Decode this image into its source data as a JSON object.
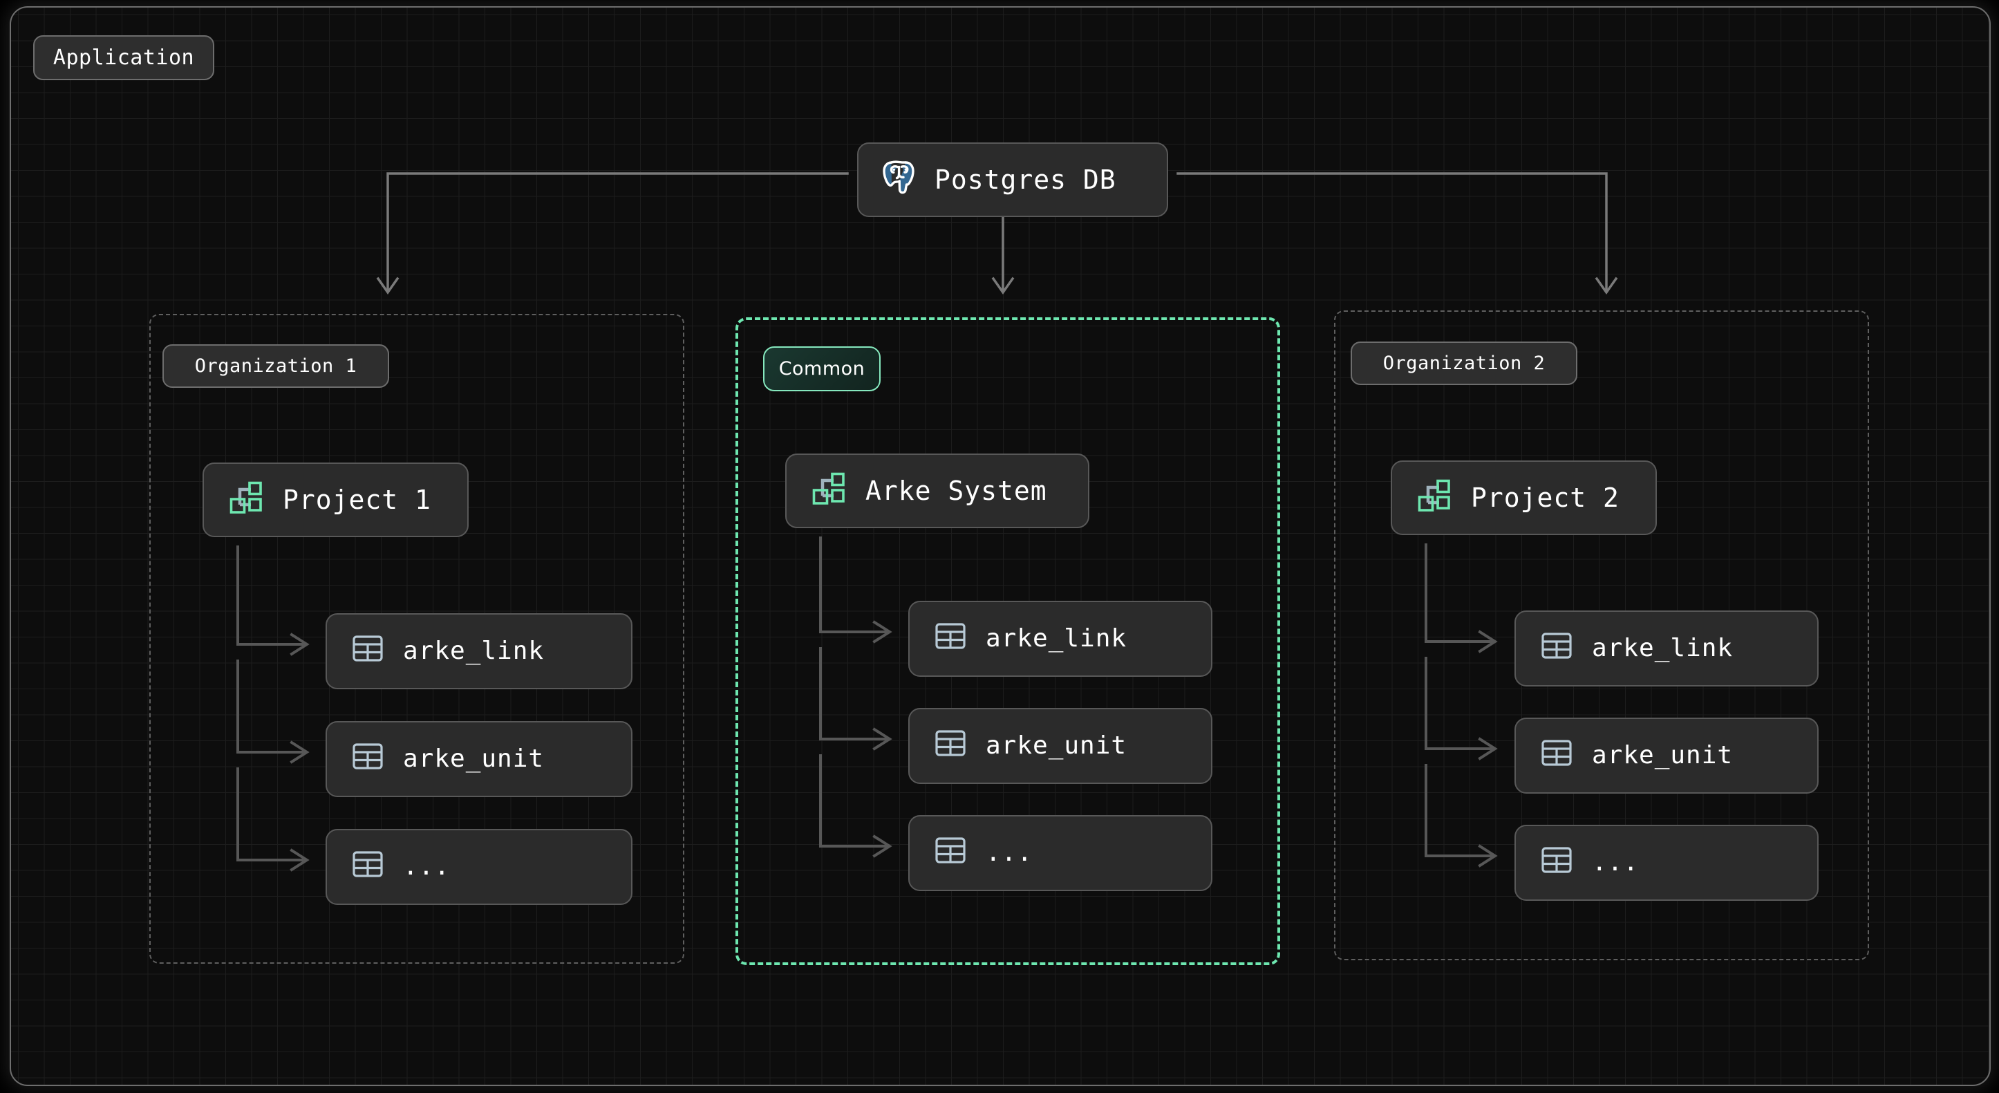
{
  "frame": {
    "title_badge": "Application"
  },
  "colors": {
    "background": "#000000",
    "canvas": "#0d0d0d",
    "grid_line": "#1d1d1d",
    "node_fill": "#2b2b2b",
    "node_border": "#585858",
    "badge_fill": "#2e2e2e",
    "badge_border": "#6d6d6d",
    "group_border": "#5f5f5f",
    "common_accent": "#6ee7b0",
    "project_icon_accent": "#6ee7b0",
    "table_icon": "#b8cad6",
    "connector": "#5a5a5a",
    "connector_top": "#7a7a7a",
    "postgres_blue": "#336791",
    "text": "#ffffff"
  },
  "root": {
    "label": "Postgres DB",
    "icon": "postgres-elephant-icon"
  },
  "groups": [
    {
      "id": "org1",
      "label": "Organization 1",
      "style": "dashed-gray",
      "project": {
        "label": "Project 1",
        "icon": "sitemap-icon"
      },
      "tables": [
        {
          "label": "arke_link",
          "icon": "table-icon"
        },
        {
          "label": "arke_unit",
          "icon": "table-icon"
        },
        {
          "label": "...",
          "icon": "table-icon"
        }
      ]
    },
    {
      "id": "common",
      "label": "Common",
      "style": "dashed-green",
      "project": {
        "label": "Arke System",
        "icon": "sitemap-icon"
      },
      "tables": [
        {
          "label": "arke_link",
          "icon": "table-icon"
        },
        {
          "label": "arke_unit",
          "icon": "table-icon"
        },
        {
          "label": "...",
          "icon": "table-icon"
        }
      ]
    },
    {
      "id": "org2",
      "label": "Organization 2",
      "style": "dashed-gray",
      "project": {
        "label": "Project 2",
        "icon": "sitemap-icon"
      },
      "tables": [
        {
          "label": "arke_link",
          "icon": "table-icon"
        },
        {
          "label": "arke_unit",
          "icon": "table-icon"
        },
        {
          "label": "...",
          "icon": "table-icon"
        }
      ]
    }
  ]
}
